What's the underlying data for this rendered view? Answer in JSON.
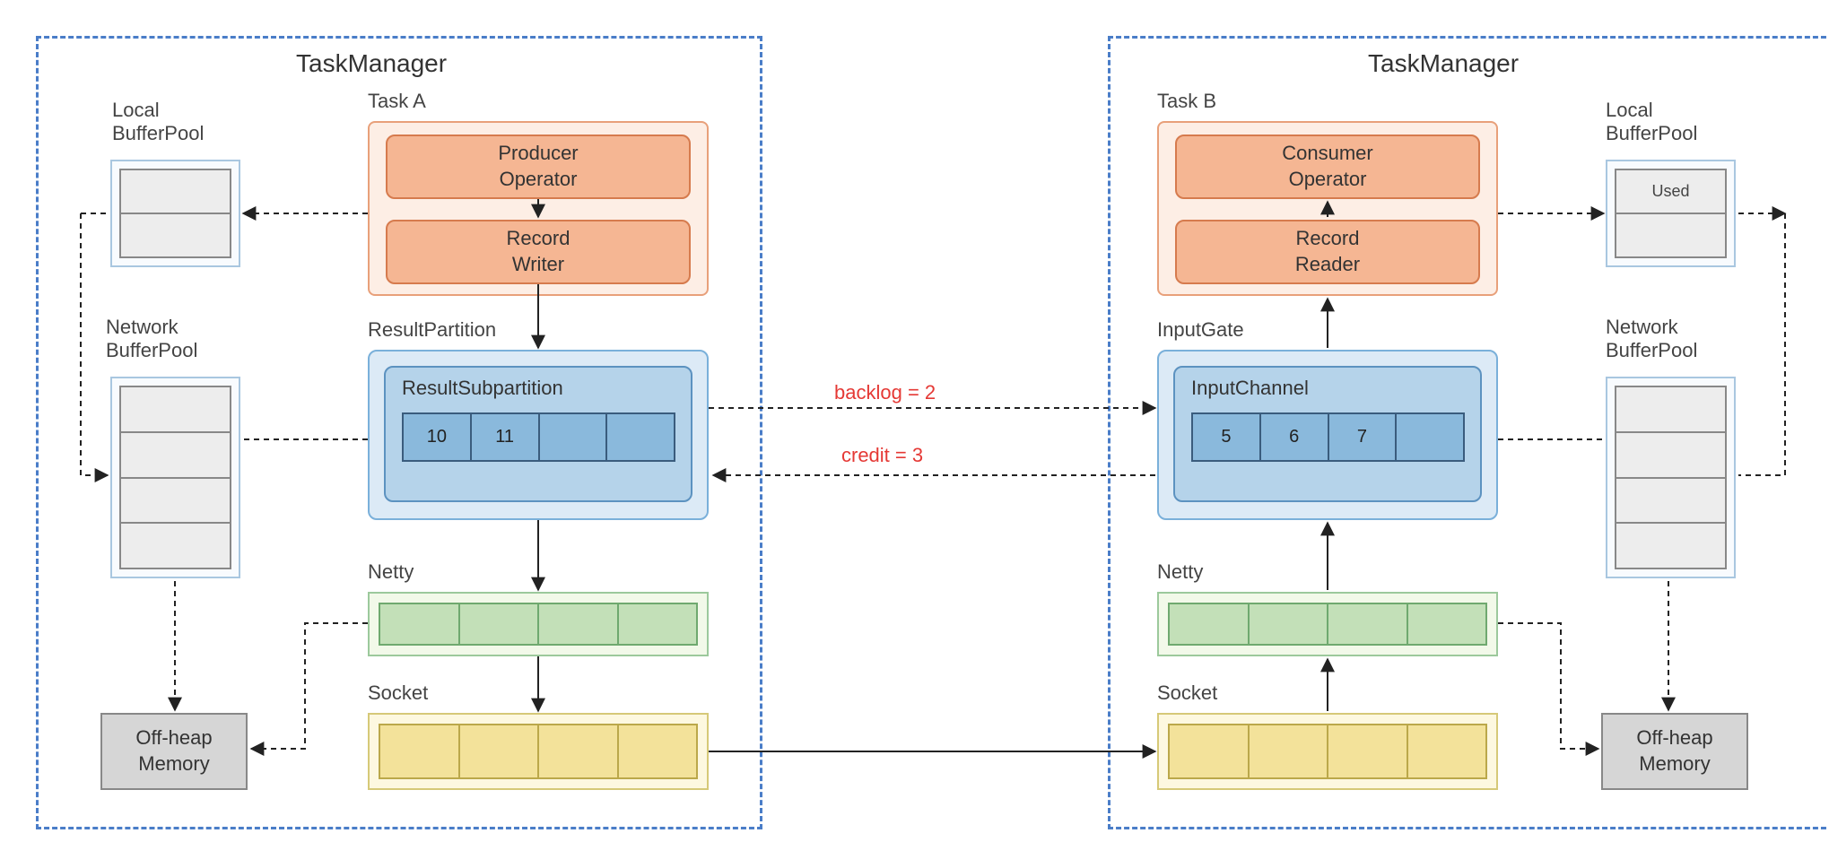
{
  "left": {
    "title": "TaskManager",
    "localBufferPool": {
      "label": "Local\nBufferPool"
    },
    "networkBufferPool": {
      "label": "Network\nBufferPool"
    },
    "offheap": "Off-heap\nMemory",
    "task": {
      "label": "Task A",
      "producer": "Producer\nOperator",
      "recordWriter": "Record\nWriter"
    },
    "resultPartition": {
      "label": "ResultPartition",
      "sub": {
        "label": "ResultSubpartition",
        "cells": [
          "10",
          "11",
          "",
          ""
        ]
      }
    },
    "netty": {
      "label": "Netty",
      "cells": 4
    },
    "socket": {
      "label": "Socket",
      "cells": 4
    }
  },
  "right": {
    "title": "TaskManager",
    "localBufferPool": {
      "label": "Local\nBufferPool",
      "usedLabel": "Used"
    },
    "networkBufferPool": {
      "label": "Network\nBufferPool"
    },
    "offheap": "Off-heap\nMemory",
    "task": {
      "label": "Task B",
      "consumer": "Consumer\nOperator",
      "recordReader": "Record\nReader"
    },
    "inputGate": {
      "label": "InputGate",
      "channel": {
        "label": "InputChannel",
        "cells": [
          "5",
          "6",
          "7",
          ""
        ]
      }
    },
    "netty": {
      "label": "Netty",
      "cells": 4
    },
    "socket": {
      "label": "Socket",
      "cells": 4
    }
  },
  "messages": {
    "backlog": "backlog = 2",
    "credit": "credit = 3"
  }
}
